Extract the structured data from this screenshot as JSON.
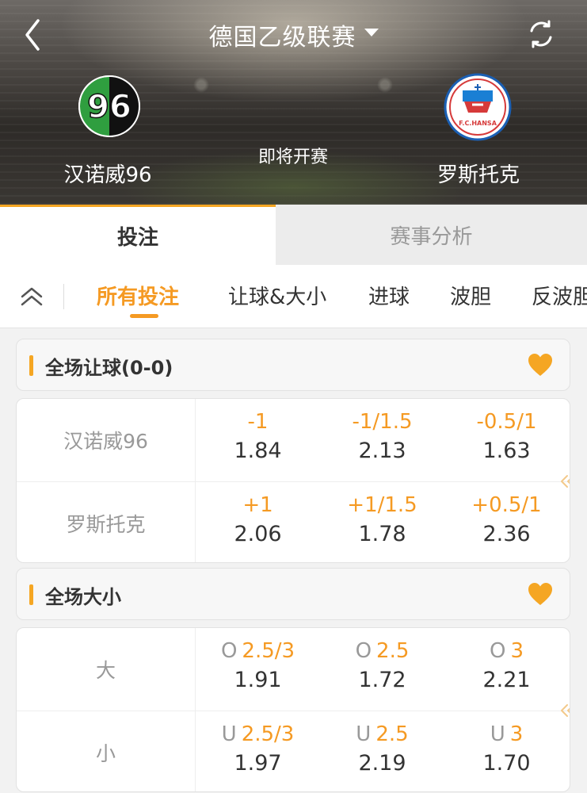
{
  "header": {
    "title": "德国乙级联赛",
    "status": "即将开赛",
    "home_team": "汉诺威96",
    "away_team": "罗斯托克",
    "home_logo_text": "96",
    "away_logo_text": "F.C.HANSA"
  },
  "main_tabs": [
    {
      "label": "投注",
      "active": true
    },
    {
      "label": "赛事分析",
      "active": false
    }
  ],
  "sub_tabs": [
    {
      "label": "所有投注",
      "active": true
    },
    {
      "label": "让球&大小",
      "active": false
    },
    {
      "label": "进球",
      "active": false
    },
    {
      "label": "波胆",
      "active": false
    },
    {
      "label": "反波胆",
      "active": false
    }
  ],
  "sections": {
    "handicap": {
      "title": "全场让球(0-0)",
      "rows": [
        {
          "label": "汉诺威96",
          "cells": [
            {
              "prefix": "",
              "line": "-1",
              "odds": "1.84"
            },
            {
              "prefix": "",
              "line": "-1/1.5",
              "odds": "2.13"
            },
            {
              "prefix": "",
              "line": "-0.5/1",
              "odds": "1.63"
            }
          ]
        },
        {
          "label": "罗斯托克",
          "cells": [
            {
              "prefix": "",
              "line": "+1",
              "odds": "2.06"
            },
            {
              "prefix": "",
              "line": "+1/1.5",
              "odds": "1.78"
            },
            {
              "prefix": "",
              "line": "+0.5/1",
              "odds": "2.36"
            }
          ]
        }
      ]
    },
    "total": {
      "title": "全场大小",
      "rows": [
        {
          "label": "大",
          "cells": [
            {
              "prefix": "O",
              "line": "2.5/3",
              "odds": "1.91"
            },
            {
              "prefix": "O",
              "line": "2.5",
              "odds": "1.72"
            },
            {
              "prefix": "O",
              "line": "3",
              "odds": "2.21"
            }
          ]
        },
        {
          "label": "小",
          "cells": [
            {
              "prefix": "U",
              "line": "2.5/3",
              "odds": "1.97"
            },
            {
              "prefix": "U",
              "line": "2.5",
              "odds": "2.19"
            },
            {
              "prefix": "U",
              "line": "3",
              "odds": "1.70"
            }
          ]
        }
      ]
    }
  },
  "colors": {
    "accent": "#f59a23",
    "favorite": "#f5a623",
    "text_muted": "#999999"
  }
}
